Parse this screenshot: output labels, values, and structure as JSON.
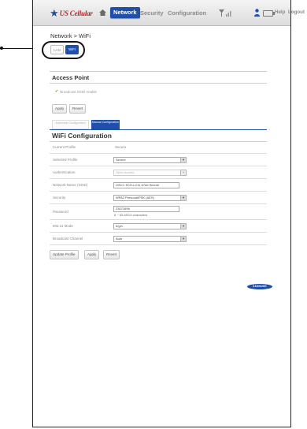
{
  "header": {
    "brand": "US Cellular",
    "nav": [
      "Network",
      "Security",
      "Configuration"
    ],
    "active_nav": "Network",
    "help": "Help",
    "logout": "Logout"
  },
  "breadcrumb": "Network > WiFi",
  "subtabs": {
    "lan": "LAN",
    "wifi": "WiFi"
  },
  "access_point": {
    "title": "Access Point",
    "broadcast_ssid": "Broadcast SSID enable",
    "apply": "Apply",
    "revert": "Revert"
  },
  "config_tabs": {
    "auto": "Automatic Configuration",
    "manual": "Manual Configuration"
  },
  "wifi": {
    "title": "WiFi Configuration",
    "rows": {
      "current_profile": {
        "label": "Current Profile",
        "value": "Secure"
      },
      "selected_profile": {
        "label": "Selected Profile",
        "value": "Secure"
      },
      "authentication": {
        "label": "Authentication",
        "value": "Open Access"
      },
      "network_name": {
        "label": "Network Name (SSID)",
        "value": "USCC SCH-LC11 b7dd Secure"
      },
      "security": {
        "label": "Security",
        "value": "WPA2 Personal/PSK (AES)"
      },
      "password": {
        "label": "Password",
        "value": "23071696",
        "note": "8 ~ 63 ASCII characters"
      },
      "mode": {
        "label": "802.11 Mode",
        "value": "b/g/n"
      },
      "channel": {
        "label": "Broadcast Channel",
        "value": "Auto"
      }
    },
    "buttons": {
      "update": "Update Profile",
      "apply": "Apply",
      "revert": "Revert"
    }
  },
  "footer_logo": "SAMSUNG",
  "colors": {
    "accent": "#1f4fa8",
    "brand_red": "#c0202a",
    "check_green": "#6aa000"
  }
}
